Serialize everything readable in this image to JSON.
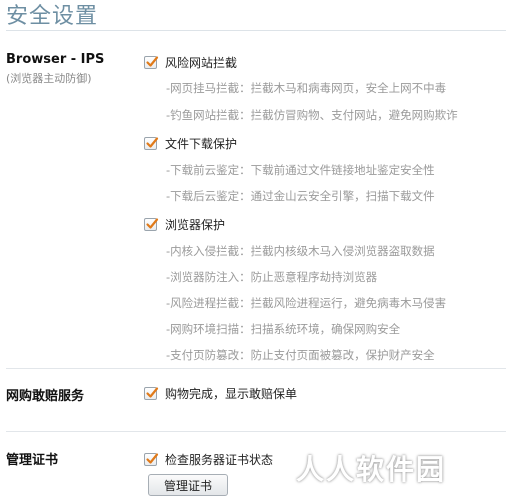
{
  "page": {
    "title": "安全设置"
  },
  "sections": {
    "browser_ips": {
      "label": "Browser - IPS",
      "sub": "浏览器主动防御",
      "groups": [
        {
          "label": "风险网站拦截",
          "checked": true,
          "details": [
            "-网页挂马拦截：拦截木马和病毒网页，安全上网不中毒",
            "-钓鱼网站拦截：拦截仿冒购物、支付网站，避免网购欺诈"
          ]
        },
        {
          "label": "文件下载保护",
          "checked": true,
          "details": [
            "-下载前云鉴定：下载前通过文件链接地址鉴定安全性",
            "-下载后云鉴定：通过金山云安全引擎，扫描下载文件"
          ]
        },
        {
          "label": "浏览器保护",
          "checked": true,
          "details": [
            "-内核入侵拦截：拦截内核级木马入侵浏览器盗取数据",
            "-浏览器防注入：防止恶意程序劫持浏览器",
            "-风险进程拦截：拦截风险进程运行，避免病毒木马侵害",
            "-网购环境扫描：扫描系统环境，确保网购安全",
            "-支付页防篡改：防止支付页面被篡改，保护财产安全"
          ]
        }
      ]
    },
    "shopping": {
      "label": "网购敢赔服务",
      "option": {
        "label": "购物完成，显示敢赔保单",
        "checked": true
      }
    },
    "certificate": {
      "label": "管理证书",
      "option": {
        "label": "检查服务器证书状态",
        "checked": true
      },
      "button_label": "管理证书"
    }
  },
  "watermark": "人人软件园",
  "colors": {
    "title": "#6e8fa3",
    "check_accent": "#e07a1a",
    "detail_text": "#9a9a9a"
  }
}
